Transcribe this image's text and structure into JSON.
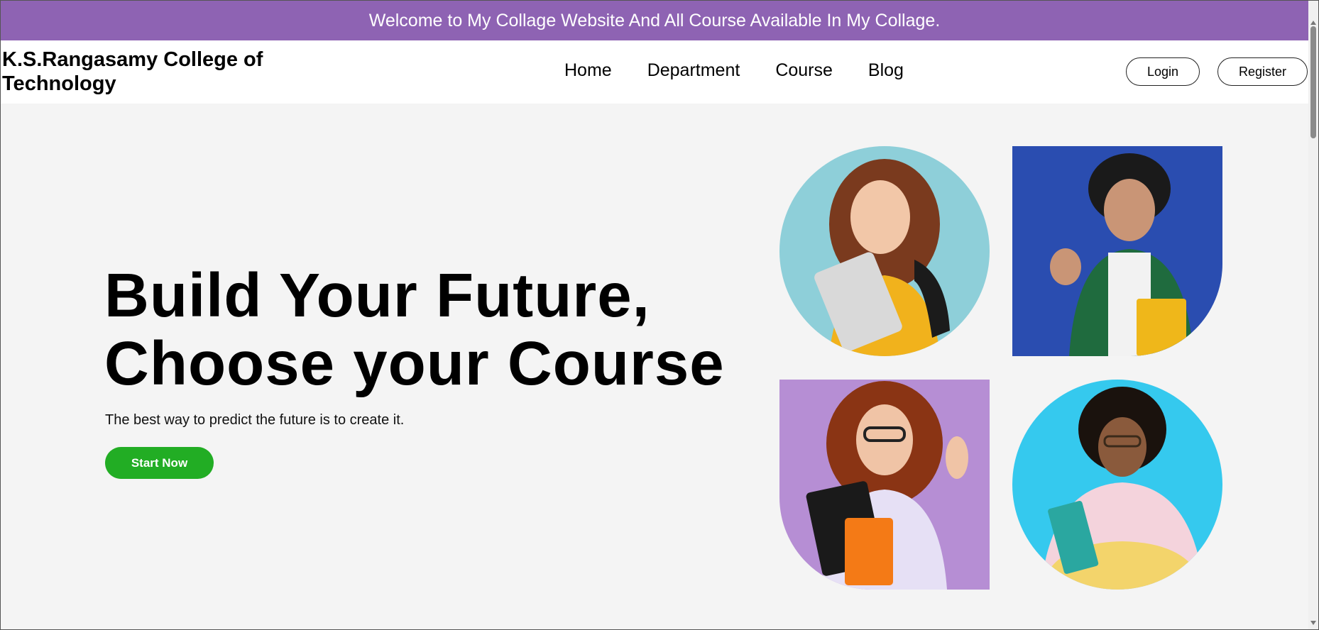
{
  "banner": {
    "text": "Welcome to My Collage Website And All Course Available In My Collage."
  },
  "header": {
    "brand": "K.S.Rangasamy College of Technology",
    "nav": [
      "Home",
      "Department",
      "Course",
      "Blog"
    ],
    "login_label": "Login",
    "register_label": "Register"
  },
  "hero": {
    "title_line1": "Build Your Future,",
    "title_line2": "Choose your Course",
    "tagline": "The best way to predict the future is to create it.",
    "cta_label": "Start Now"
  },
  "colors": {
    "banner": "#8e63b3",
    "cta": "#22ad24",
    "background": "#f4f4f4"
  },
  "icons": [
    "student-photo-1",
    "student-photo-2",
    "student-photo-3",
    "student-photo-4"
  ]
}
